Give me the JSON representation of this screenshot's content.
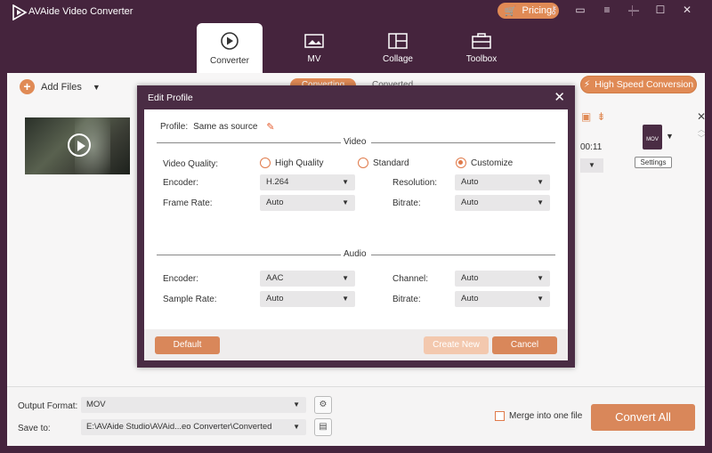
{
  "app": {
    "title": "AVAide Video Converter",
    "pricing_label": "Pricing",
    "window_icons": [
      "key-icon",
      "chat-icon",
      "menu-icon",
      "minimize-icon",
      "maximize-icon",
      "close-icon"
    ]
  },
  "nav": {
    "tabs": [
      {
        "label": "Converter",
        "icon": "converter-icon",
        "active": true
      },
      {
        "label": "MV",
        "icon": "mv-icon",
        "active": false
      },
      {
        "label": "Collage",
        "icon": "collage-icon",
        "active": false
      },
      {
        "label": "Toolbox",
        "icon": "toolbox-icon",
        "active": false
      }
    ]
  },
  "toolbar": {
    "add_files_label": "Add Files",
    "segment_active": "Converting",
    "segment_inactive": "Converted",
    "high_speed_label": "High Speed Conversion"
  },
  "file_item": {
    "duration_partial": "00:11",
    "format_badge": "MOV",
    "settings_label": "Settings"
  },
  "dialog": {
    "title": "Edit Profile",
    "profile_label": "Profile:",
    "profile_value": "Same as source",
    "video_section": "Video",
    "audio_section": "Audio",
    "video": {
      "quality_label": "Video Quality:",
      "quality_options": [
        "High Quality",
        "Standard",
        "Customize"
      ],
      "quality_selected": "Customize",
      "encoder_label": "Encoder:",
      "encoder_value": "H.264",
      "resolution_label": "Resolution:",
      "resolution_value": "Auto",
      "framerate_label": "Frame Rate:",
      "framerate_value": "Auto",
      "bitrate_label": "Bitrate:",
      "bitrate_value": "Auto"
    },
    "audio": {
      "encoder_label": "Encoder:",
      "encoder_value": "AAC",
      "channel_label": "Channel:",
      "channel_value": "Auto",
      "samplerate_label": "Sample Rate:",
      "samplerate_value": "Auto",
      "bitrate_label": "Bitrate:",
      "bitrate_value": "Auto"
    },
    "buttons": {
      "default_label": "Default",
      "create_new_label": "Create New",
      "cancel_label": "Cancel"
    }
  },
  "bottom": {
    "output_format_label": "Output Format:",
    "output_format_value": "MOV",
    "save_to_label": "Save to:",
    "save_to_value": "E:\\AVAide Studio\\AVAid...eo Converter\\Converted",
    "merge_label": "Merge into one file",
    "convert_all_label": "Convert All"
  },
  "colors": {
    "chrome": "#45243d",
    "accent": "#e08a55",
    "dialog_frame": "#4a2c44"
  }
}
